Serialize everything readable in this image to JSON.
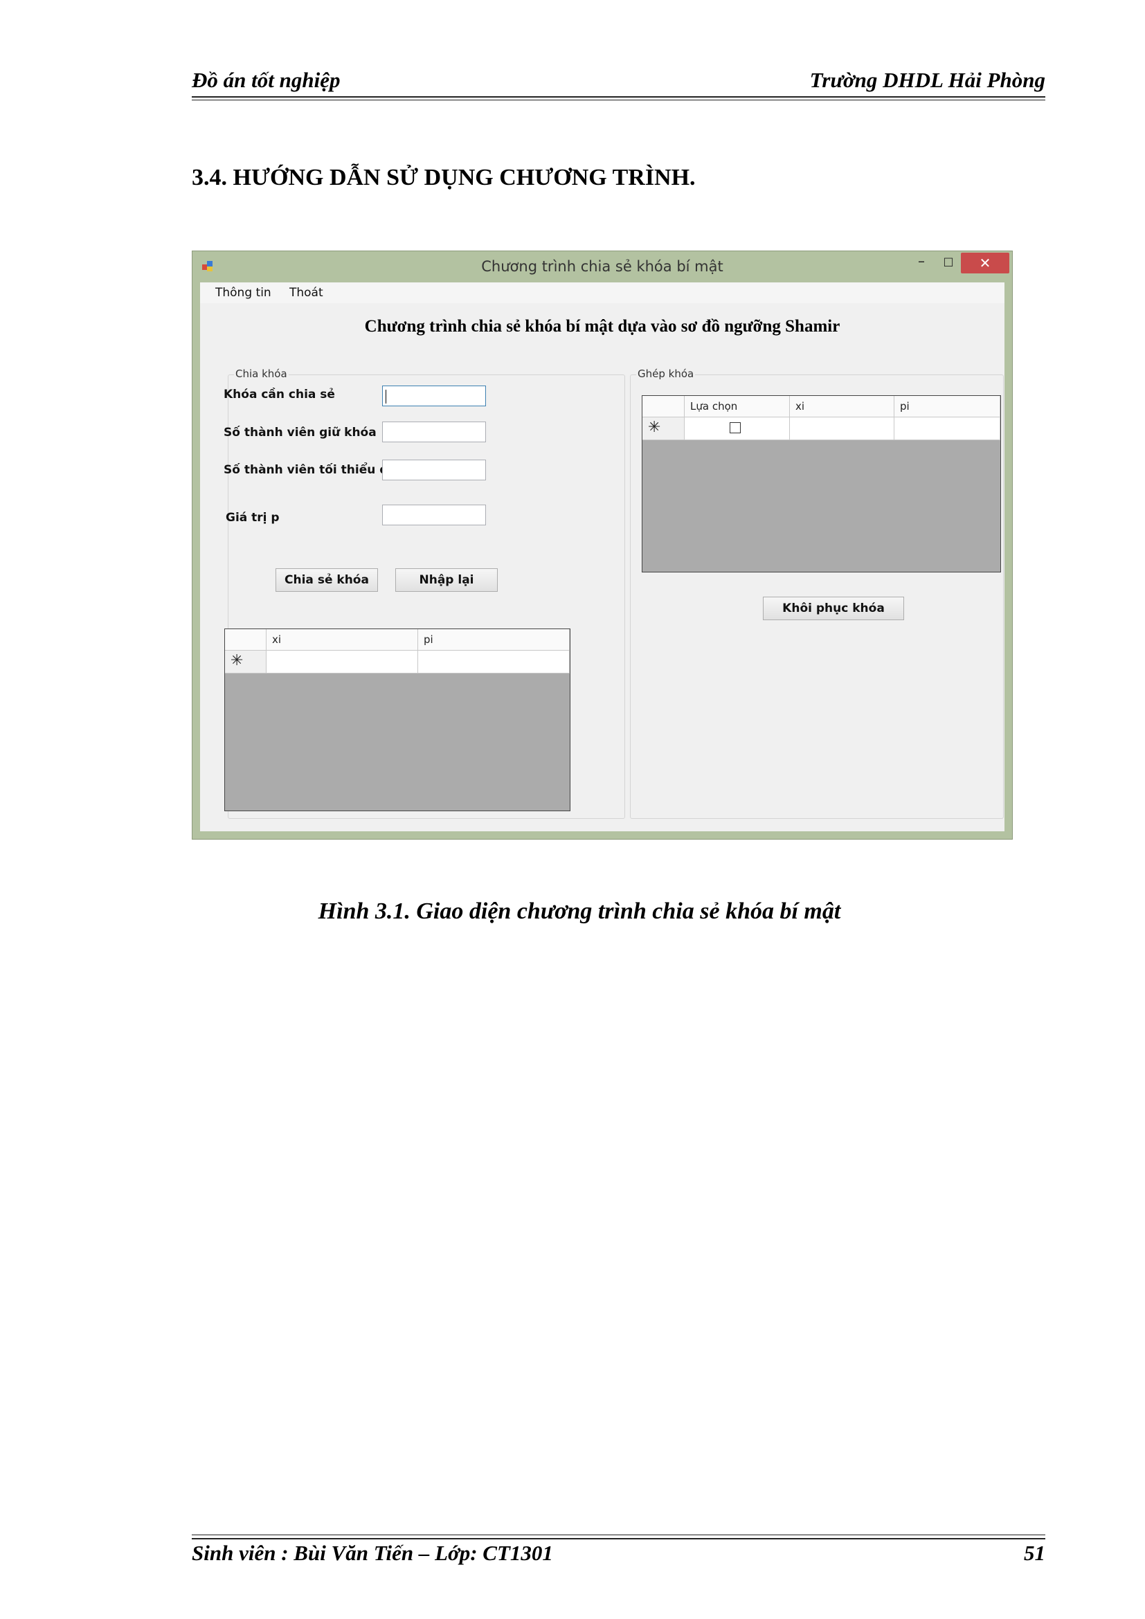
{
  "header": {
    "left": "Đồ án tốt nghiệp",
    "right": "Trường DHDL Hải Phòng"
  },
  "section_title": "3.4.  HƯỚNG DẪN SỬ DỤNG CHƯƠNG TRÌNH.",
  "window": {
    "title": "Chương trình chia sẻ khóa bí mật",
    "min_glyph": "–",
    "max_glyph": "□",
    "close_glyph": "✕",
    "menu": [
      "Thông tin",
      "Thoát"
    ],
    "form_title": "Chương trình chia sẻ khóa bí mật dựa vào sơ đồ ngưỡng Shamir",
    "share_group": {
      "label": "Chia khóa",
      "fields": [
        {
          "label": "Khóa cần chia sẻ",
          "value": ""
        },
        {
          "label": "Số thành viên giữ khóa",
          "value": ""
        },
        {
          "label": "Số thành viên tối thiểu để mở khóa",
          "value": ""
        },
        {
          "label": "Giá trị p",
          "value": ""
        }
      ],
      "buttons": {
        "share": "Chia sẻ khóa",
        "reset": "Nhập lại"
      },
      "grid": {
        "columns": [
          "",
          "xi",
          "pi"
        ],
        "new_row_marker": "✳"
      }
    },
    "combine_group": {
      "label": "Ghép khóa",
      "grid": {
        "columns": [
          "",
          "Lựa chọn",
          "xi",
          "pi"
        ],
        "new_row_marker": "✳"
      },
      "button": "Khôi phục khóa"
    }
  },
  "caption": "Hình 3.1. Giao diện chương trình chia sẻ khóa bí mật",
  "footer": {
    "left": "Sinh viên : Bùi Văn Tiến – Lớp: CT1301",
    "page": "51"
  }
}
